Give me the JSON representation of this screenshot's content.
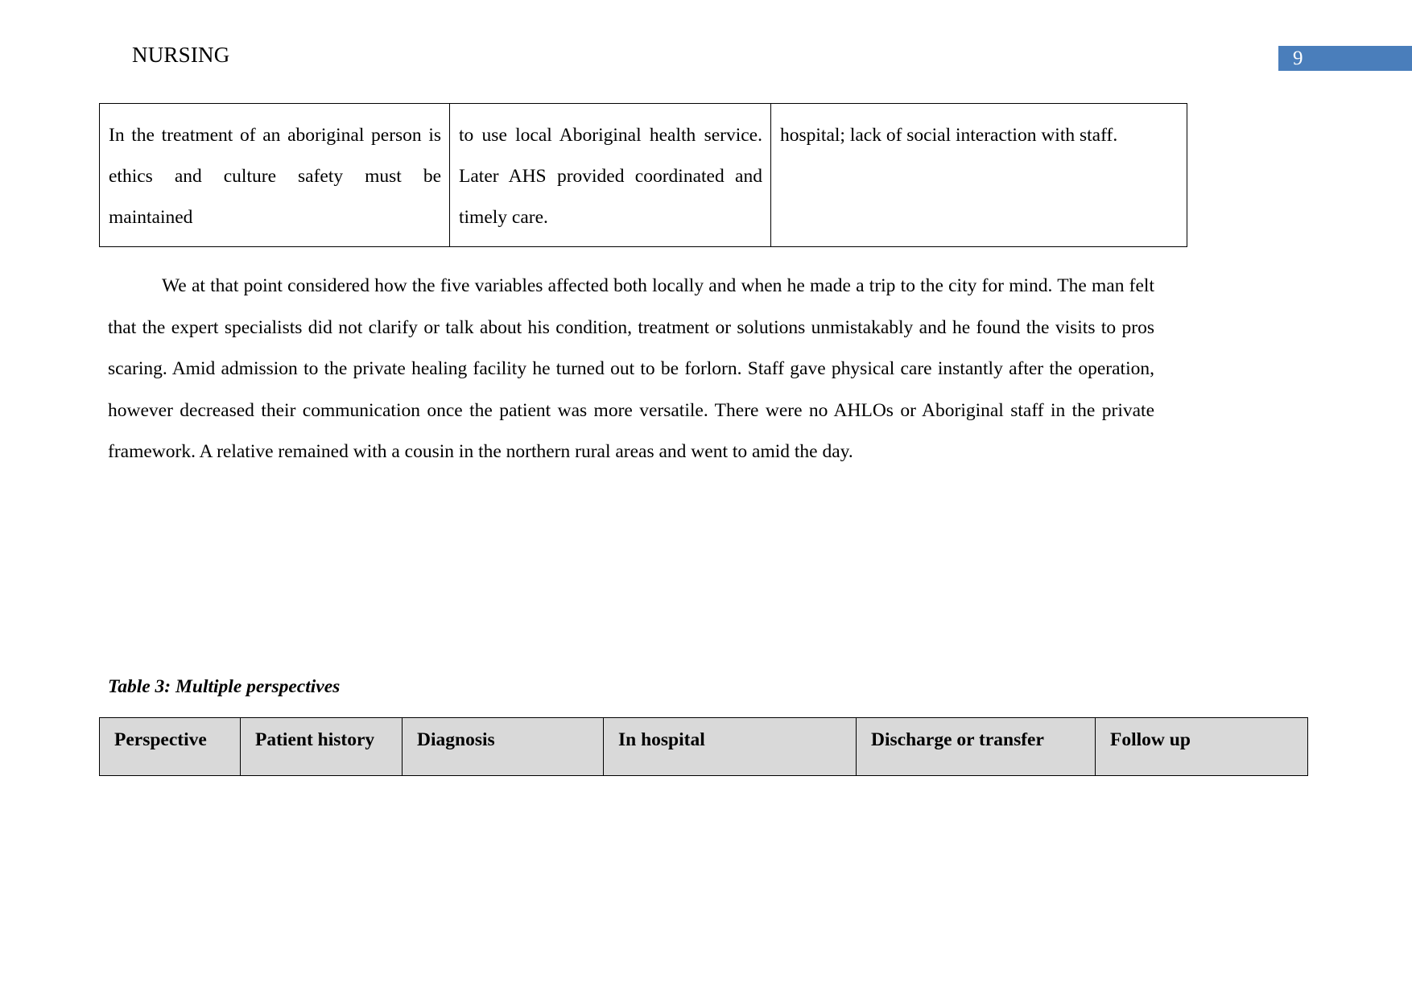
{
  "document": {
    "header_title": "NURSING",
    "page_number": "9",
    "page_number_badge_color": "#4a7ebb",
    "page_background": "#ffffff",
    "text_color": "#000000"
  },
  "continued_table": {
    "columns": 3,
    "rows": [
      {
        "cells": [
          "In the treatment of an aboriginal person is ethics and culture safety must be maintained",
          "to use local Aboriginal health service. Later AHS provided coordinated and timely care.",
          "hospital; lack of social interaction with staff."
        ]
      }
    ]
  },
  "body": {
    "paragraph": "We at that point considered how the five variables affected both locally and when he made a trip to the city for mind. The man felt that the expert specialists did not clarify or talk about his condition, treatment or solutions unmistakably and he found the visits to pros scaring. Amid admission to the private healing facility he turned out to be forlorn. Staff gave physical care instantly after the operation, however decreased their communication once the patient was more versatile. There were no AHLOs or Aboriginal staff in the private framework. A relative remained with a cousin in the northern rural areas and went to amid the day."
  },
  "table_three": {
    "caption": "Table 3: Multiple perspectives",
    "header_background": "#d9d9d9",
    "headers": [
      "Perspective",
      "Patient history",
      "Diagnosis",
      "In hospital",
      "Discharge or transfer",
      "Follow up"
    ]
  }
}
